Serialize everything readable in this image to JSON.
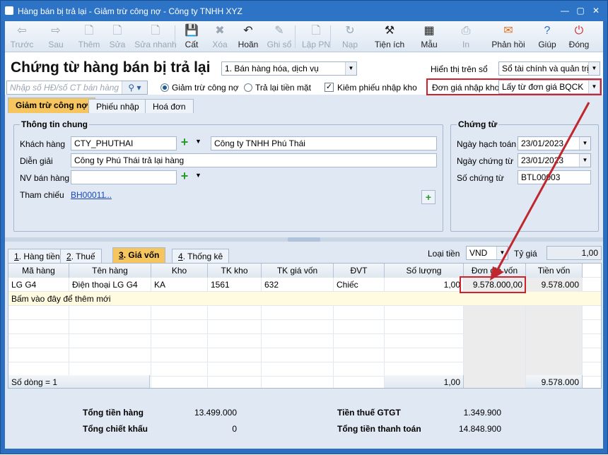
{
  "window": {
    "title": "Hàng bán bị trả lại - Giảm trừ công nợ - Công ty TNHH XYZ"
  },
  "toolbar": [
    {
      "label": "Trước",
      "icon": "arrow-left-icon",
      "enabled": false
    },
    {
      "label": "Sau",
      "icon": "arrow-right-icon",
      "enabled": false
    },
    {
      "label": "Thêm",
      "icon": "add-document-icon",
      "enabled": false
    },
    {
      "label": "Sửa",
      "icon": "edit-document-icon",
      "enabled": false
    },
    {
      "label": "Sửa nhanh",
      "icon": "quick-edit-icon",
      "enabled": false
    },
    {
      "label": "Cất",
      "icon": "save-icon",
      "enabled": true
    },
    {
      "label": "Xóa",
      "icon": "delete-icon",
      "enabled": false
    },
    {
      "label": "Hoãn",
      "icon": "undo-icon",
      "enabled": true
    },
    {
      "label": "Ghi sổ",
      "icon": "pencil-icon",
      "enabled": false
    },
    {
      "label": "Lập PN",
      "icon": "receipt-icon",
      "enabled": false
    },
    {
      "label": "Nạp",
      "icon": "reload-icon",
      "enabled": false
    },
    {
      "label": "Tiện ích",
      "icon": "tools-icon",
      "enabled": true
    },
    {
      "label": "Mẫu",
      "icon": "template-icon",
      "enabled": true
    },
    {
      "label": "In",
      "icon": "print-icon",
      "enabled": false
    },
    {
      "label": "Phản hồi",
      "icon": "feedback-icon",
      "enabled": true
    },
    {
      "label": "Giúp",
      "icon": "help-icon",
      "enabled": true
    },
    {
      "label": "Đóng",
      "icon": "close-icon",
      "enabled": true
    }
  ],
  "header": {
    "page_title": "Chứng từ hàng bán bị trả lại",
    "sale_type": "1. Bán hàng hóa, dịch vụ",
    "display_label": "Hiển thị trên sổ",
    "display_value": "Sổ tài chính và quản trị",
    "search_placeholder": "Nhập số HĐ/số CT bán hàng",
    "radio_debt": "Giảm trừ công nợ",
    "radio_cash": "Trả lại tiền mặt",
    "check_receipt": "Kiêm phiếu nhập kho",
    "price_label": "Đơn giá nhập kho",
    "price_value": "Lấy từ đơn giá BQCK"
  },
  "tabs": [
    "Giảm trừ công nợ",
    "Phiếu nhập",
    "Hoá đơn"
  ],
  "general": {
    "title": "Thông tin chung",
    "customer_label": "Khách hàng",
    "customer_code": "CTY_PHUTHAI",
    "customer_name": "Công ty TNHH Phú Thái",
    "desc_label": "Diễn giải",
    "desc_value": "Công ty Phú Thái trả lại hàng",
    "staff_label": "NV bán hàng",
    "ref_label": "Tham chiếu",
    "ref_value": "BH00011",
    "ref_more": "..."
  },
  "voucher": {
    "title": "Chứng từ",
    "post_date_label": "Ngày hạch toán",
    "post_date": "23/01/2023",
    "voucher_date_label": "Ngày chứng từ",
    "voucher_date": "23/01/2023",
    "number_label": "Số chứng từ",
    "number": "BTL00003"
  },
  "detail_tabs": [
    {
      "num": "1",
      "label": ". Hàng tiền"
    },
    {
      "num": "2",
      "label": ". Thuế"
    },
    {
      "num": "3",
      "label": ". Giá vốn"
    },
    {
      "num": "4",
      "label": ". Thống kê"
    }
  ],
  "currency": {
    "label": "Loại tiền",
    "value": "VND",
    "rate_label": "Tỷ giá",
    "rate": "1,00"
  },
  "grid": {
    "columns": [
      "Mã hàng",
      "Tên hàng",
      "Kho",
      "TK kho",
      "TK giá vốn",
      "ĐVT",
      "Số lượng",
      "Đơn giá vốn",
      "Tiền vốn"
    ],
    "rows": [
      [
        "LG G4",
        "Điện thoại LG G4",
        "KA",
        "1561",
        "632",
        "Chiếc",
        "1,00",
        "9.578.000,00",
        "9.578.000"
      ]
    ],
    "add_hint": "Bấm vào đây để thêm mới",
    "footer_count": "Số dòng = 1",
    "footer_qty": "1,00",
    "footer_total": "9.578.000"
  },
  "totals": {
    "goods_label": "Tổng tiền hàng",
    "goods": "13.499.000",
    "discount_label": "Tổng chiết khấu",
    "discount": "0",
    "vat_label": "Tiền thuế GTGT",
    "vat": "1.349.900",
    "pay_label": "Tổng tiền thanh toán",
    "pay": "14.848.900"
  }
}
